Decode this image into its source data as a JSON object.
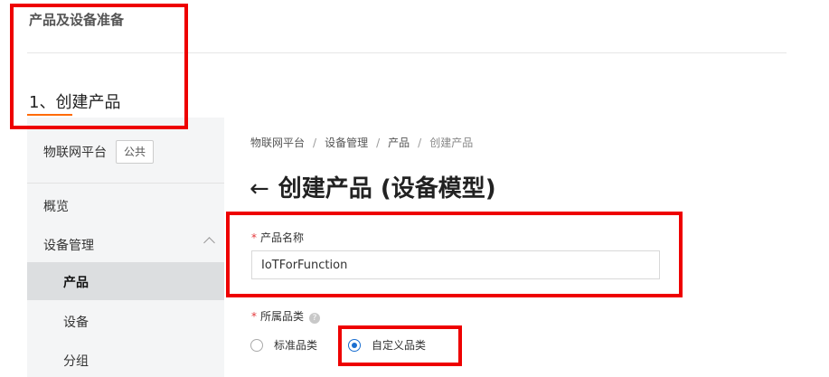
{
  "document": {
    "section_title": "产品及设备准备",
    "step_title": "1、创建产品"
  },
  "sidebar": {
    "title": "物联网平台",
    "badge": "公共",
    "items": [
      {
        "label": "概览"
      },
      {
        "label": "设备管理",
        "expanded": true
      },
      {
        "label": "产品",
        "active": true
      },
      {
        "label": "设备"
      },
      {
        "label": "分组"
      }
    ]
  },
  "breadcrumb": [
    "物联网平台",
    "设备管理",
    "产品",
    "创建产品"
  ],
  "breadcrumb_sep": "/",
  "page": {
    "back_icon": "←",
    "title": "创建产品 (设备模型)"
  },
  "form": {
    "required_mark": "*",
    "product_name": {
      "label": "产品名称",
      "value": "IoTForFunction"
    },
    "category": {
      "label": "所属品类",
      "help_icon": "?",
      "options": [
        {
          "label": "标准品类",
          "selected": false
        },
        {
          "label": "自定义品类",
          "selected": true
        }
      ]
    }
  },
  "colors": {
    "accent_orange": "#ff6a00",
    "annotation_red": "#ee0000",
    "radio_blue": "#1a6ed0",
    "required_red": "#e4393c"
  }
}
